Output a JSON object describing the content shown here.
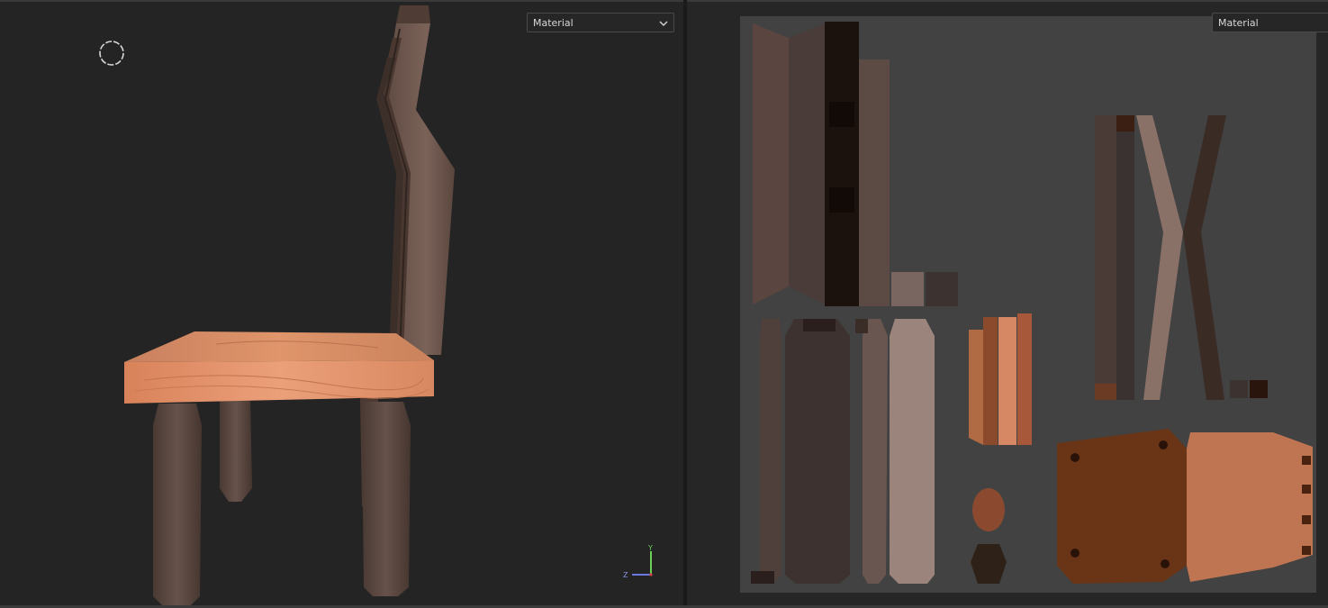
{
  "viewport_3d": {
    "shading_dropdown": {
      "value": "Material"
    },
    "axis_gizmo": {
      "y_label": "Y",
      "z_label": "Z"
    }
  },
  "viewport_uv": {
    "shading_dropdown": {
      "value": "Material"
    }
  },
  "icons": {
    "navigation_gizmo": "dashed-circle-icon",
    "dropdown_arrow": "chevron-down-icon"
  },
  "colors": {
    "viewport_bg": "#242424",
    "uv_sheet_bg": "#424242",
    "seat_wood": "#d98a62",
    "leg_wood": "#5a4740",
    "axis_y": "#6ccf5a",
    "axis_z": "#6b79e0"
  }
}
